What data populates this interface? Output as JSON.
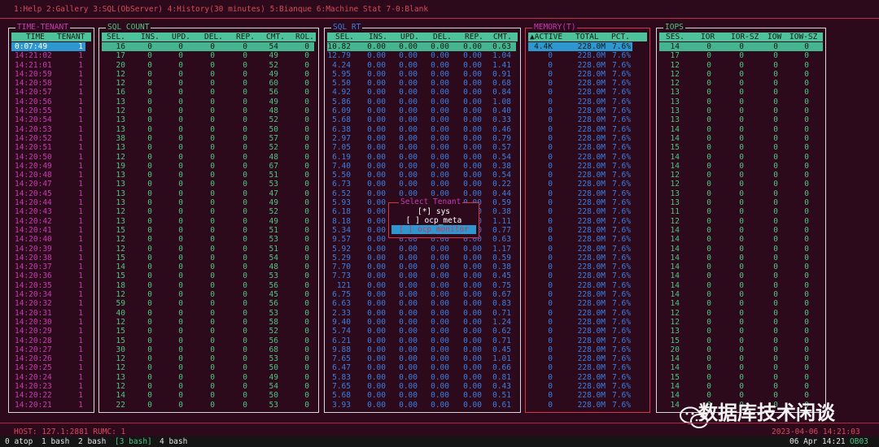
{
  "menu": "1:Help 2:Gallery 3:SQL(ObServer) 4:History(30 minutes) 5:Bianque 6:Machine Stat 7-0:Blank",
  "colors": {
    "background": "#2c0a1c",
    "header_bg": "#4ec29b",
    "selection_bg": "#2f97cf",
    "magenta": "#c83ab4",
    "green": "#4fc47f",
    "blue": "#3c7fe0",
    "red": "#d84a5c"
  },
  "panels": [
    {
      "id": "time",
      "title": "TIME-TENANT",
      "headers": [
        "TIME",
        "TENANT"
      ],
      "selected": [
        "0:07:49",
        "1"
      ]
    },
    {
      "id": "sqlcount",
      "title": "SQL COUNT",
      "headers": [
        "SEL.",
        "INS.",
        "UPD.",
        "DEL.",
        "REP.",
        "CMT.",
        "ROL."
      ],
      "selected": [
        "16",
        "0",
        "0",
        "0",
        "0",
        "54",
        "0"
      ]
    },
    {
      "id": "sqlrt",
      "title": "SQL RT",
      "headers": [
        "SEL.",
        "INS.",
        "UPD.",
        "DEL.",
        "REP.",
        "CMT."
      ],
      "selected": [
        "10.82",
        "0.00",
        "0.00",
        "0.00",
        "0.00",
        "0.63"
      ]
    },
    {
      "id": "memory",
      "title": "MEMORY(T)",
      "headers": [
        "▲ACTIVE",
        "TOTAL",
        "PCT."
      ],
      "selected": [
        "4.4K",
        "228.0M",
        "7.6%"
      ]
    },
    {
      "id": "iops",
      "title": "IOPS",
      "headers": [
        "SES.",
        "IOR",
        "IOR-SZ",
        "IOW",
        "IOW-SZ"
      ],
      "selected": [
        "14",
        "0",
        "0",
        "0",
        "0"
      ]
    }
  ],
  "times": [
    "14:21:02",
    "14:21:01",
    "14:20:59",
    "14:20:58",
    "14:20:57",
    "14:20:56",
    "14:20:55",
    "14:20:54",
    "14:20:53",
    "14:20:52",
    "14:20:51",
    "14:20:50",
    "14:20:49",
    "14:20:48",
    "14:20:47",
    "14:20:45",
    "14:20:44",
    "14:20:43",
    "14:20:42",
    "14:20:41",
    "14:20:40",
    "14:20:39",
    "14:20:38",
    "14:20:37",
    "14:20:36",
    "14:20:35",
    "14:20:34",
    "14:20:32",
    "14:20:31",
    "14:20:30",
    "14:20:29",
    "14:20:28",
    "14:20:27",
    "14:20:26",
    "14:20:25",
    "14:20:24",
    "14:20:23",
    "14:20:22",
    "14:20:21"
  ],
  "tenant_value": "1",
  "sel_counts": [
    "17",
    "20",
    "12",
    "12",
    "16",
    "13",
    "12",
    "13",
    "13",
    "38",
    "13",
    "12",
    "19",
    "13",
    "13",
    "13",
    "13",
    "12",
    "13",
    "15",
    "12",
    "12",
    "15",
    "14",
    "15",
    "18",
    "12",
    "59",
    "40",
    "12",
    "15",
    "15",
    "30",
    "12",
    "12",
    "13",
    "12",
    "14",
    "22"
  ],
  "cmt_counts": [
    "49",
    "52",
    "49",
    "60",
    "56",
    "49",
    "48",
    "52",
    "50",
    "57",
    "52",
    "48",
    "67",
    "51",
    "53",
    "47",
    "49",
    "52",
    "49",
    "51",
    "53",
    "51",
    "54",
    "48",
    "53",
    "56",
    "45",
    "56",
    "53",
    "58",
    "52",
    "56",
    "68",
    "53",
    "50",
    "49",
    "54",
    "50",
    "53"
  ],
  "rt_sel": [
    "12.79",
    "4.24",
    "5.95",
    "5.50",
    "4.92",
    "5.86",
    "6.09",
    "5.68",
    "6.38",
    "2.97",
    "7.05",
    "6.19",
    "7.40",
    "5.50",
    "6.73",
    "6.52",
    "5.93",
    "6.18",
    "8.18",
    "5.34",
    "9.57",
    "5.92",
    "5.29",
    "7.70",
    "7.73",
    "121",
    "6.75",
    "6.63",
    "2.33",
    "9.40",
    "5.74",
    "6.21",
    "9.88",
    "7.65",
    "6.47",
    "5.83",
    "7.65",
    "5.68",
    "3.93"
  ],
  "rt_cmt": [
    "1.04",
    "1.41",
    "0.91",
    "0.68",
    "0.84",
    "1.08",
    "0.40",
    "0.33",
    "0.46",
    "0.79",
    "0.57",
    "0.54",
    "0.38",
    "0.54",
    "0.22",
    "0.44",
    "0.59",
    "0.38",
    "1.11",
    "0.77",
    "0.63",
    "1.17",
    "0.59",
    "0.38",
    "0.45",
    "0.75",
    "0.67",
    "0.83",
    "0.71",
    "1.24",
    "0.62",
    "0.71",
    "0.45",
    "1.01",
    "0.66",
    "0.81",
    "0.43",
    "0.51",
    "0.61"
  ],
  "mem_active": "0",
  "mem_total": "228.0M",
  "mem_pct": "7.6%",
  "ses_values": [
    "17",
    "12",
    "12",
    "12",
    "13",
    "13",
    "13",
    "13",
    "14",
    "14",
    "15",
    "14",
    "14",
    "12",
    "12",
    "13",
    "13",
    "11",
    "12",
    "14",
    "14",
    "14",
    "14",
    "14",
    "14",
    "14",
    "14",
    "14",
    "12",
    "12",
    "13",
    "15",
    "20",
    "14",
    "14",
    "15",
    "14",
    "14",
    "14"
  ],
  "zero": "0",
  "zero_f": "0.00",
  "popup": {
    "title": "Select Tenant",
    "options": [
      "[*] sys",
      "[ ] ocp_meta",
      "[ ] ocp_monitor"
    ]
  },
  "footer": {
    "left": "HOST: 127.1:2881 RUMC: 1",
    "right": "2023-04-06 14:21:03"
  },
  "tmux": {
    "windows": [
      "0 atop",
      "1 bash",
      "2 bash",
      "[3 bash]",
      "4 bash"
    ],
    "right": "06 Apr 14:21",
    "host": "OB03"
  },
  "watermark": "数据库技术闲谈",
  "icons": {
    "watermark": "wechat-icon"
  }
}
